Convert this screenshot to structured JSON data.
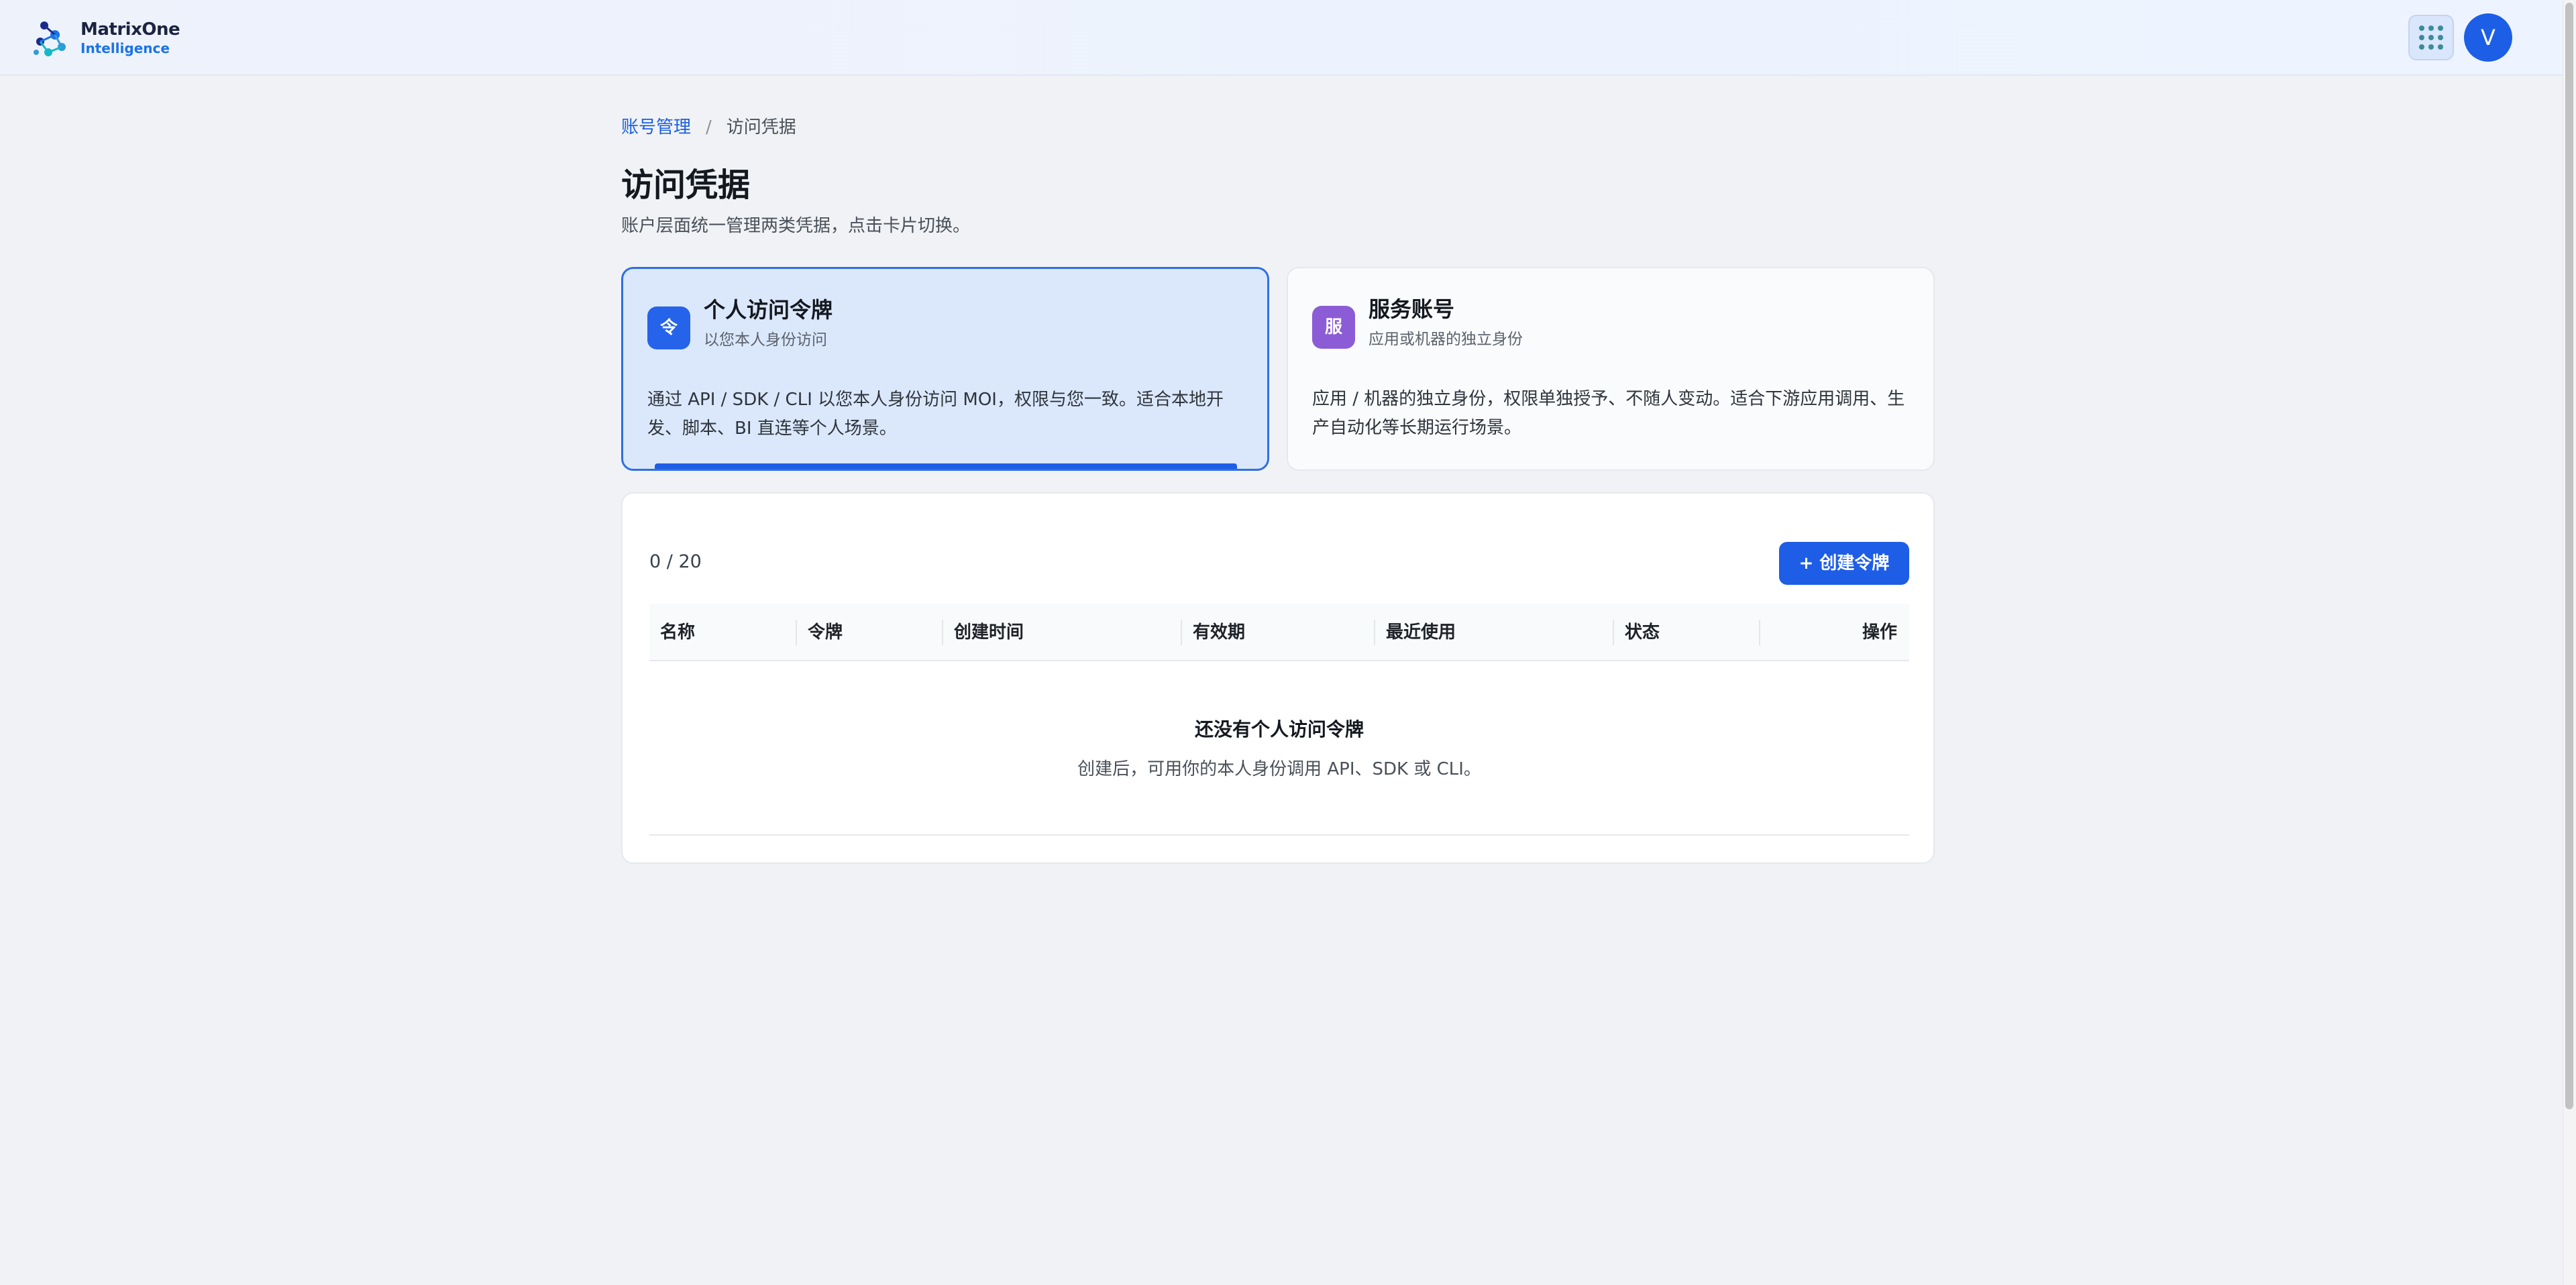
{
  "header": {
    "logo_name": "MatrixOne",
    "logo_sub": "Intelligence",
    "avatar_initial": "V",
    "apps_icon": "grid-dots-icon"
  },
  "breadcrumb": {
    "parent": "账号管理",
    "separator": "/",
    "current": "访问凭据"
  },
  "page": {
    "title": "访问凭据",
    "description": "账户层面统一管理两类凭据，点击卡片切换。"
  },
  "cards": [
    {
      "icon_text": "令",
      "icon_color": "#2563eb",
      "title": "个人访问令牌",
      "subtitle": "以您本人身份访问",
      "body": "通过 API / SDK / CLI 以您本人身份访问 MOI，权限与您一致。适合本地开发、脚本、BI 直连等个人场景。",
      "active": true
    },
    {
      "icon_text": "服",
      "icon_color": "#8b5cd6",
      "title": "服务账号",
      "subtitle": "应用或机器的独立身份",
      "body": "应用 / 机器的独立身份，权限单独授予、不随人变动。适合下游应用调用、生产自动化等长期运行场景。",
      "active": false
    }
  ],
  "table": {
    "count": "0 / 20",
    "create_button": "+ 创建令牌",
    "columns": [
      "名称",
      "令牌",
      "创建时间",
      "有效期",
      "最近使用",
      "状态",
      "操作"
    ],
    "rows": [],
    "empty_title": "还没有个人访问令牌",
    "empty_desc": "创建后，可用你的本人身份调用 API、SDK 或 CLI。"
  },
  "colors": {
    "accent": "#1e5de6",
    "active_card_bg": "#dbe8fc",
    "page_bg": "#f0f2f5"
  }
}
